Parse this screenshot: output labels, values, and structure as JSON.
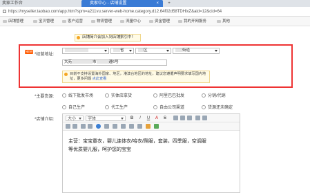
{
  "browser": {
    "tab1_label": "卖家工作台",
    "tab2_label": "卖家中心 - 店铺设置",
    "tab2_close": "×",
    "new_tab": "+",
    "address_url": "https://myseller.taobao.com/app.htm?spm=a211vu.server-web-home.category.d12.64f02d58TDHlxZ&aid=12&cid=64",
    "bookmarks": [
      "店铺管理",
      "宝贝管理",
      "客户运营",
      "物流管理",
      "流量中心",
      "资金管理",
      "我的开网服务",
      "其他"
    ]
  },
  "notice": {
    "text": "店铺简介会加入到店铺索引中！"
  },
  "address_section": {
    "badge": "NEW",
    "label": "*经营地址:",
    "selects": [
      {
        "name": "country",
        "value": ""
      },
      {
        "name": "province",
        "value": "省"
      },
      {
        "name": "city",
        "value": "区"
      },
      {
        "name": "district",
        "value": "街道"
      }
    ],
    "detail_prefix": "大苑",
    "detail_mid": "市",
    "detail_suffix": "遵6号",
    "tip_text": "目前不支持设置海外国家、地区，港澳台地区的地址，建议您遵循声明要求填写国内地址，更多问题",
    "tip_link": "点此查看"
  },
  "main_source": {
    "label": "*主要货源:",
    "options": [
      "线下批发市场",
      "实体店拿货",
      "阿里巴巴批发",
      "分销/代销",
      "自己生产",
      "代工生产",
      "自由公司渠道",
      "货源还未确定"
    ]
  },
  "store_intro": {
    "label": "*店铺介绍:",
    "toolbar_size": "大小",
    "toolbar_font": "字体",
    "toolbar_buttons": [
      "B",
      "I",
      "U",
      "A",
      "S"
    ],
    "content": "主营：宝宝童衣，婴儿连体衣/哈衣/爬服，套装，四季服，空调服等优质婴儿服，呵护您的宝宝"
  }
}
